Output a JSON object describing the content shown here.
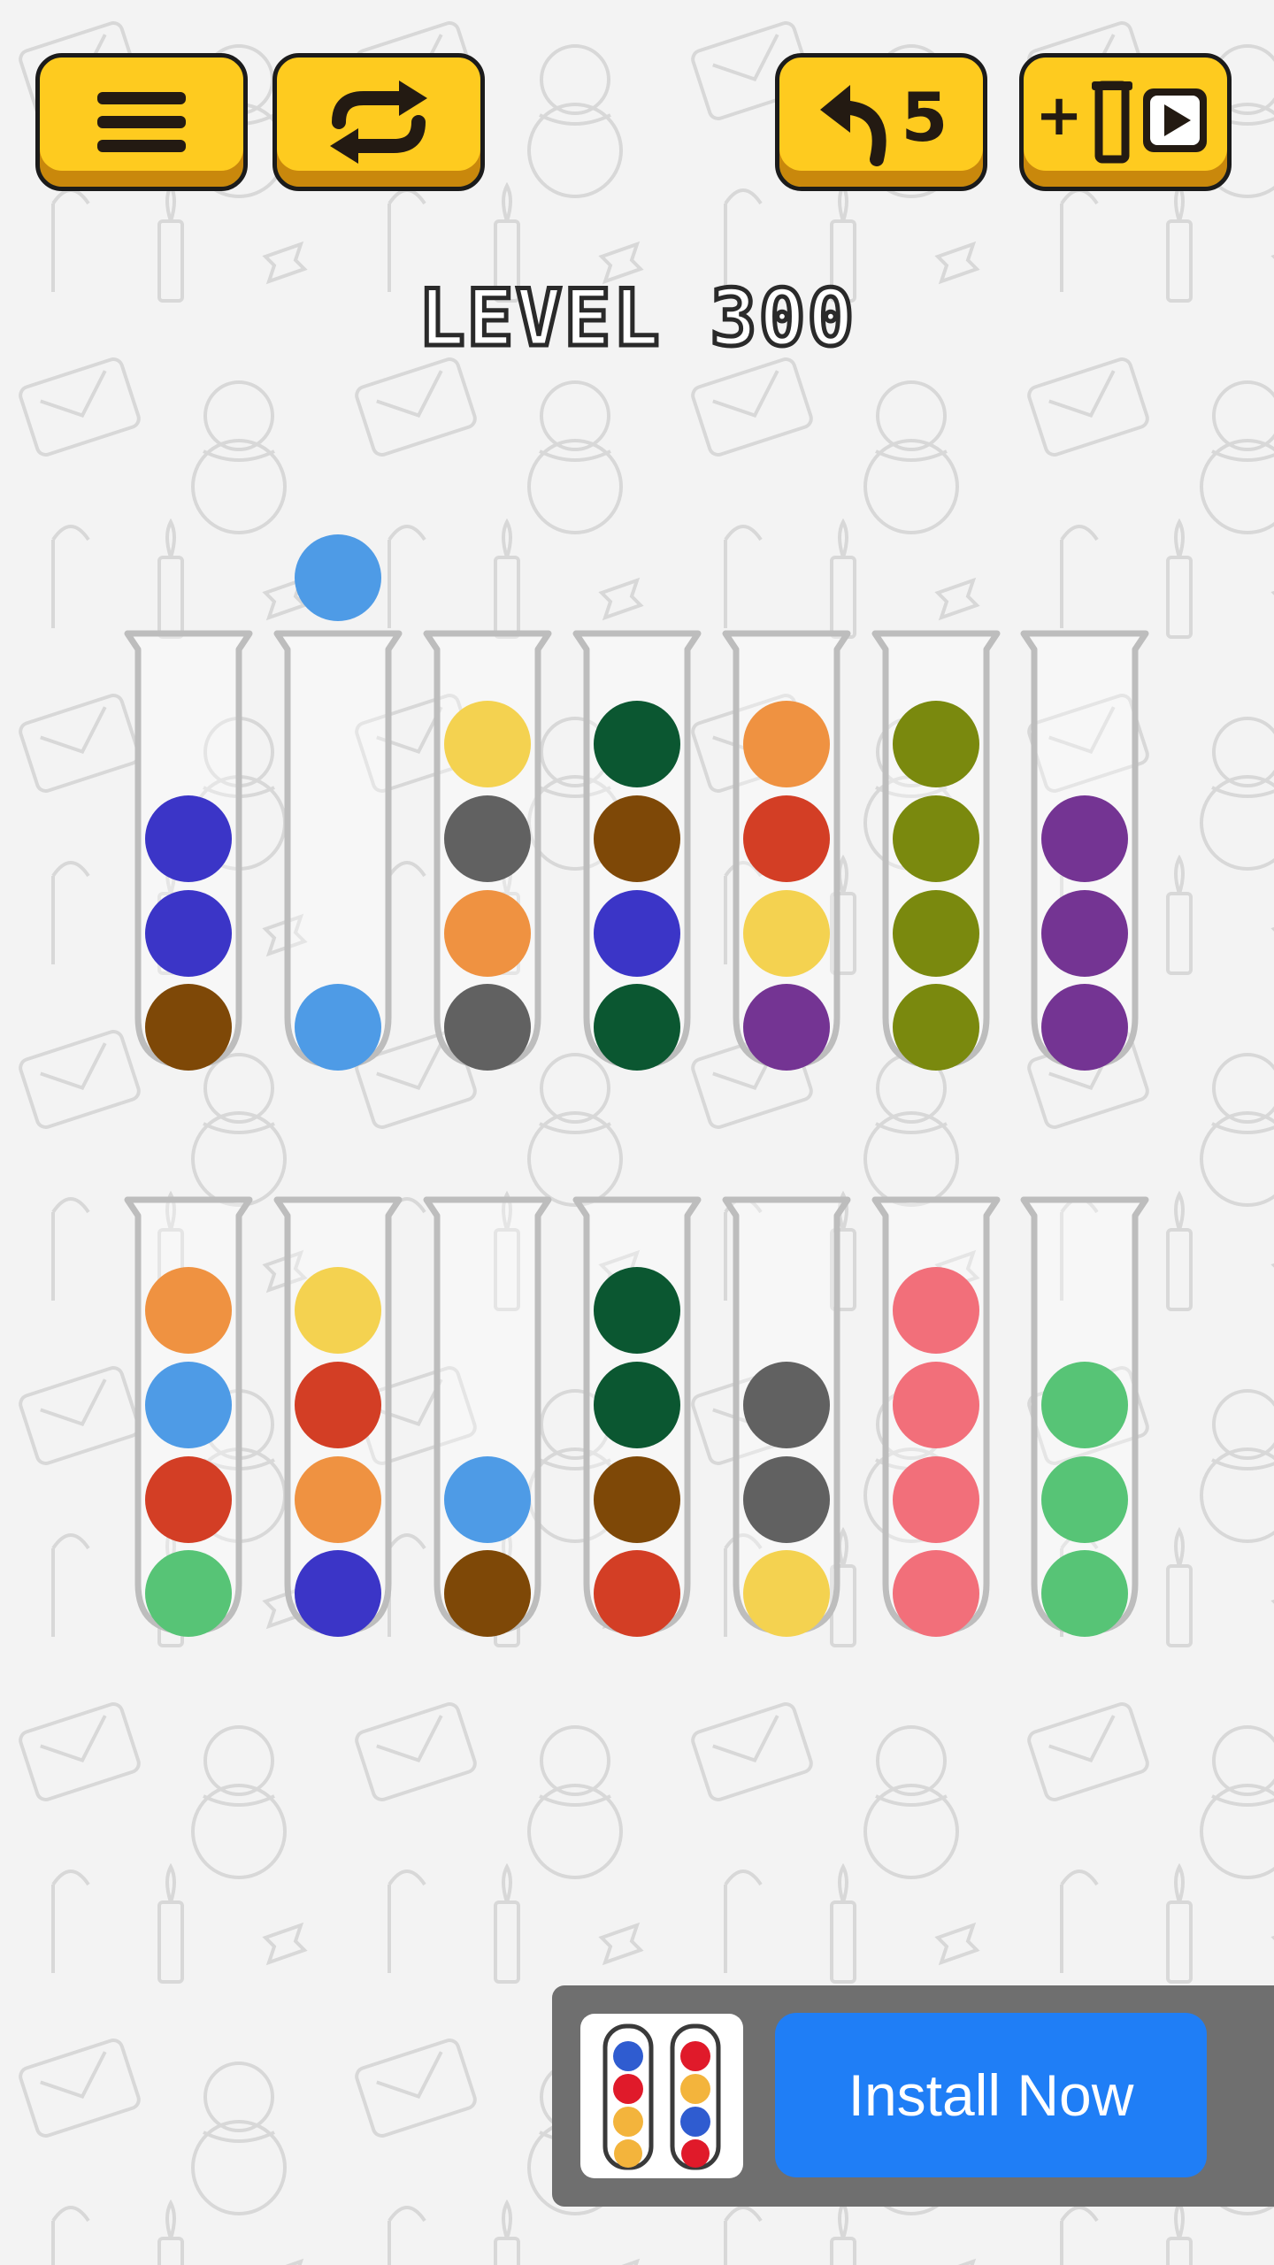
{
  "toolbar": {
    "menu_icon": "hamburger-icon",
    "restart_icon": "restart-arrows-icon",
    "undo_icon": "undo-arrow-icon",
    "undo_count": "5",
    "add_tube_label": "+",
    "add_tube_icon": "tube-video-icon"
  },
  "level": {
    "title": "LEVEL 300"
  },
  "colors": {
    "button_yellow": "#fecb1f",
    "button_shadow": "#c9880c",
    "indigo": "#3b35c7",
    "brown": "#7e4807",
    "light_blue": "#4e9be6",
    "yellow": "#f4d250",
    "gray": "#616161",
    "orange": "#ef9241",
    "dark_green": "#0b5731",
    "red": "#d33e25",
    "purple": "#743493",
    "olive": "#7a890e",
    "pink": "#f26f7a",
    "green": "#57c476",
    "ad_blue": "#1f7ef6"
  },
  "selected_ball": {
    "color": "light_blue",
    "from_tube": 2
  },
  "tubes": [
    {
      "row": 1,
      "index": 1,
      "balls_top_to_bottom": [
        "indigo",
        "indigo",
        "brown"
      ]
    },
    {
      "row": 1,
      "index": 2,
      "balls_top_to_bottom": [
        "light_blue"
      ]
    },
    {
      "row": 1,
      "index": 3,
      "balls_top_to_bottom": [
        "yellow",
        "gray",
        "orange",
        "gray"
      ]
    },
    {
      "row": 1,
      "index": 4,
      "balls_top_to_bottom": [
        "dark_green",
        "brown",
        "indigo",
        "dark_green"
      ]
    },
    {
      "row": 1,
      "index": 5,
      "balls_top_to_bottom": [
        "orange",
        "red",
        "yellow",
        "purple"
      ]
    },
    {
      "row": 1,
      "index": 6,
      "balls_top_to_bottom": [
        "olive",
        "olive",
        "olive",
        "olive"
      ]
    },
    {
      "row": 1,
      "index": 7,
      "balls_top_to_bottom": [
        "purple",
        "purple",
        "purple"
      ]
    },
    {
      "row": 2,
      "index": 1,
      "balls_top_to_bottom": [
        "orange",
        "light_blue",
        "red",
        "green"
      ]
    },
    {
      "row": 2,
      "index": 2,
      "balls_top_to_bottom": [
        "yellow",
        "red",
        "orange",
        "indigo"
      ]
    },
    {
      "row": 2,
      "index": 3,
      "balls_top_to_bottom": [
        "light_blue",
        "brown"
      ]
    },
    {
      "row": 2,
      "index": 4,
      "balls_top_to_bottom": [
        "dark_green",
        "dark_green",
        "brown",
        "red"
      ]
    },
    {
      "row": 2,
      "index": 5,
      "balls_top_to_bottom": [
        "gray",
        "gray",
        "yellow"
      ]
    },
    {
      "row": 2,
      "index": 6,
      "balls_top_to_bottom": [
        "pink",
        "pink",
        "pink",
        "pink"
      ]
    },
    {
      "row": 2,
      "index": 7,
      "balls_top_to_bottom": [
        "green",
        "green",
        "green"
      ]
    }
  ],
  "ad": {
    "icon": "ball-sort-app-icon",
    "install_label": "Install Now"
  }
}
